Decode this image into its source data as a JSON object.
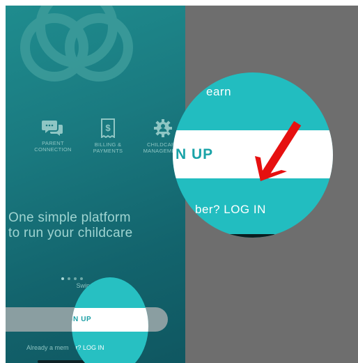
{
  "features": [
    {
      "icon": "chat-bubbles-icon",
      "label": "PARENT\nCONNECTION"
    },
    {
      "icon": "receipt-dollar-icon",
      "label": "BILLING &\nPAYMENTS"
    },
    {
      "icon": "gear-person-icon",
      "label": "CHILDCARE\nMANAGEMENT"
    }
  ],
  "tagline": "One simple platform\nto run your childcare",
  "swipe_text": "Swipe to learn",
  "signup_label": "SIGN UP",
  "member_prefix": "Already a mem",
  "member_suffix": "ber? LOG IN",
  "zoom": {
    "top_text": "earn",
    "band_text": "N UP",
    "login_text": "ber? LOG IN"
  },
  "colors": {
    "teal": "#22bdc0",
    "arrow": "#e61010",
    "gray": "#6e6e6e"
  }
}
